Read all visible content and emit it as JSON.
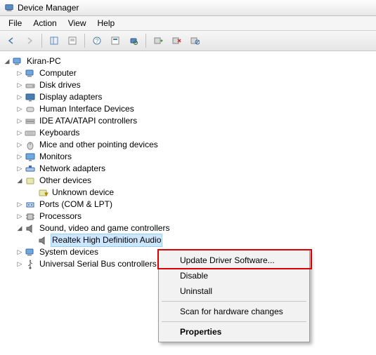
{
  "window": {
    "title": "Device Manager"
  },
  "menu": {
    "file": "File",
    "action": "Action",
    "view": "View",
    "help": "Help"
  },
  "tree": {
    "root": "Kiran-PC",
    "items": [
      "Computer",
      "Disk drives",
      "Display adapters",
      "Human Interface Devices",
      "IDE ATA/ATAPI controllers",
      "Keyboards",
      "Mice and other pointing devices",
      "Monitors",
      "Network adapters"
    ],
    "other_devices": {
      "label": "Other devices",
      "child": "Unknown device"
    },
    "after_other": [
      "Ports (COM & LPT)",
      "Processors"
    ],
    "sound": {
      "label": "Sound, video and game controllers",
      "child": "Realtek High Definition Audio"
    },
    "after_sound": [
      "System devices",
      "Universal Serial Bus controllers"
    ]
  },
  "context": {
    "update": "Update Driver Software...",
    "disable": "Disable",
    "uninstall": "Uninstall",
    "scan": "Scan for hardware changes",
    "properties": "Properties"
  }
}
